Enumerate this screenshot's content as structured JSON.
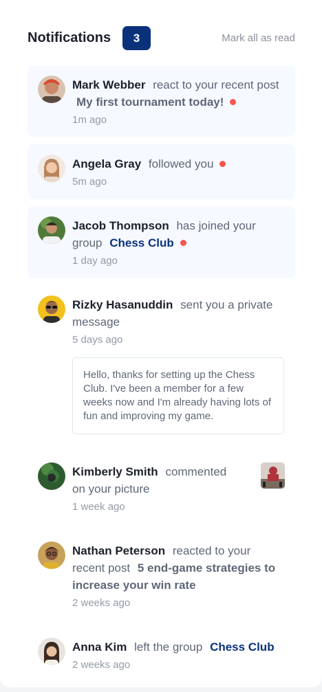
{
  "header": {
    "title": "Notifications",
    "count": "3",
    "mark_all_label": "Mark all as read"
  },
  "notifications": [
    {
      "name": "Mark Webber",
      "action": "react to your recent post",
      "post": "My first tournament today!",
      "time": "1m ago",
      "unread": true
    },
    {
      "name": "Angela Gray",
      "action": "followed you",
      "time": "5m ago",
      "unread": true
    },
    {
      "name": "Jacob Thompson",
      "action": "has joined your group",
      "group": "Chess Club",
      "time": "1 day ago",
      "unread": true
    },
    {
      "name": "Rizky Hasanuddin",
      "action": "sent you a private message",
      "time": "5 days ago",
      "unread": false,
      "message": "Hello, thanks for setting up the Chess Club. I've been a member for a few weeks now and I'm already having lots of fun and improving my game."
    },
    {
      "name": "Kimberly Smith",
      "action": "commented on your picture",
      "time": "1 week ago",
      "unread": false
    },
    {
      "name": "Nathan Peterson",
      "action": "reacted to your recent post",
      "post": "5 end-game strategies to increase your win rate",
      "time": "2 weeks ago",
      "unread": false
    },
    {
      "name": "Anna Kim",
      "action": "left the group",
      "group": "Chess Club",
      "time": "2 weeks ago",
      "unread": false
    }
  ],
  "colors": {
    "unread_bg": "#f6f9ff",
    "badge": "#0a327b",
    "dot": "#f65552",
    "group_link": "#0a327b"
  }
}
